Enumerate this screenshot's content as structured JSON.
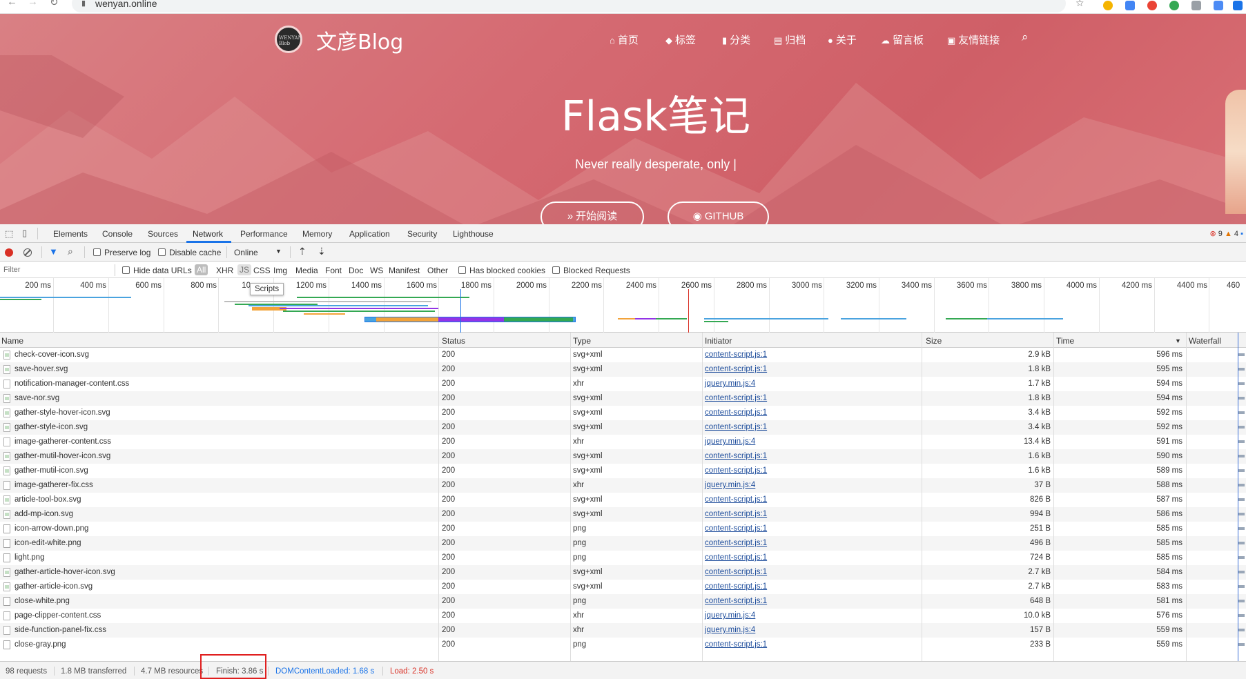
{
  "browser": {
    "url": "wenyan.online"
  },
  "site": {
    "title": "文彦Blog",
    "logo_text": "WENYAN Blob",
    "nav": [
      {
        "icon": "⌂",
        "label": "首页",
        "name": "nav-home"
      },
      {
        "icon": "◆",
        "label": "标签",
        "name": "nav-tags"
      },
      {
        "icon": "▮",
        "label": "分类",
        "name": "nav-categories"
      },
      {
        "icon": "▤",
        "label": "归档",
        "name": "nav-archive"
      },
      {
        "icon": "●",
        "label": "关于",
        "name": "nav-about"
      },
      {
        "icon": "☁",
        "label": "留言板",
        "name": "nav-guestbook"
      },
      {
        "icon": "▣",
        "label": "友情链接",
        "name": "nav-links"
      }
    ],
    "post_title": "Flask笔记",
    "subtitle": "Never really desperate, only |",
    "buttons": {
      "read": "开始阅读",
      "github": "GITHUB"
    }
  },
  "devtools": {
    "tabs": [
      "Elements",
      "Console",
      "Sources",
      "Network",
      "Performance",
      "Memory",
      "Application",
      "Security",
      "Lighthouse"
    ],
    "active_tab": "Network",
    "counters": {
      "errors": "9",
      "warnings": "4"
    },
    "toolbar": {
      "preserve_log": "Preserve log",
      "disable_cache": "Disable cache",
      "throttle": "Online"
    },
    "filter": {
      "placeholder": "Filter",
      "hide_data_urls": "Hide data URLs",
      "types": [
        "All",
        "XHR",
        "JS",
        "CSS",
        "Img",
        "Media",
        "Font",
        "Doc",
        "WS",
        "Manifest",
        "Other"
      ],
      "has_blocked_cookies": "Has blocked cookies",
      "blocked_requests": "Blocked Requests"
    },
    "timeline_ticks": [
      "200 ms",
      "400 ms",
      "600 ms",
      "800 ms",
      "10",
      "1200 ms",
      "1400 ms",
      "1600 ms",
      "1800 ms",
      "2000 ms",
      "2200 ms",
      "2400 ms",
      "2600 ms",
      "2800 ms",
      "3000 ms",
      "3200 ms",
      "3400 ms",
      "3600 ms",
      "3800 ms",
      "4000 ms",
      "4200 ms",
      "4400 ms",
      "460"
    ],
    "tooltip": "Scripts",
    "columns": [
      "Name",
      "Status",
      "Type",
      "Initiator",
      "Size",
      "Time",
      "Waterfall"
    ],
    "rows": [
      {
        "name": "check-cover-icon.svg",
        "status": "200",
        "type": "svg+xml",
        "initiator": "content-script.js:1",
        "size": "2.9 kB",
        "time": "596 ms",
        "icon": "svg"
      },
      {
        "name": "save-hover.svg",
        "status": "200",
        "type": "svg+xml",
        "initiator": "content-script.js:1",
        "size": "1.8 kB",
        "time": "595 ms",
        "icon": "svg"
      },
      {
        "name": "notification-manager-content.css",
        "status": "200",
        "type": "xhr",
        "initiator": "jquery.min.js:4",
        "size": "1.7 kB",
        "time": "594 ms",
        "icon": "doc"
      },
      {
        "name": "save-nor.svg",
        "status": "200",
        "type": "svg+xml",
        "initiator": "content-script.js:1",
        "size": "1.8 kB",
        "time": "594 ms",
        "icon": "svg"
      },
      {
        "name": "gather-style-hover-icon.svg",
        "status": "200",
        "type": "svg+xml",
        "initiator": "content-script.js:1",
        "size": "3.4 kB",
        "time": "592 ms",
        "icon": "svg"
      },
      {
        "name": "gather-style-icon.svg",
        "status": "200",
        "type": "svg+xml",
        "initiator": "content-script.js:1",
        "size": "3.4 kB",
        "time": "592 ms",
        "icon": "svg"
      },
      {
        "name": "image-gatherer-content.css",
        "status": "200",
        "type": "xhr",
        "initiator": "jquery.min.js:4",
        "size": "13.4 kB",
        "time": "591 ms",
        "icon": "doc"
      },
      {
        "name": "gather-mutil-hover-icon.svg",
        "status": "200",
        "type": "svg+xml",
        "initiator": "content-script.js:1",
        "size": "1.6 kB",
        "time": "590 ms",
        "icon": "svg"
      },
      {
        "name": "gather-mutil-icon.svg",
        "status": "200",
        "type": "svg+xml",
        "initiator": "content-script.js:1",
        "size": "1.6 kB",
        "time": "589 ms",
        "icon": "svg"
      },
      {
        "name": "image-gatherer-fix.css",
        "status": "200",
        "type": "xhr",
        "initiator": "jquery.min.js:4",
        "size": "37 B",
        "time": "588 ms",
        "icon": "doc"
      },
      {
        "name": "article-tool-box.svg",
        "status": "200",
        "type": "svg+xml",
        "initiator": "content-script.js:1",
        "size": "826 B",
        "time": "587 ms",
        "icon": "svg"
      },
      {
        "name": "add-mp-icon.svg",
        "status": "200",
        "type": "svg+xml",
        "initiator": "content-script.js:1",
        "size": "994 B",
        "time": "586 ms",
        "icon": "svg"
      },
      {
        "name": "icon-arrow-down.png",
        "status": "200",
        "type": "png",
        "initiator": "content-script.js:1",
        "size": "251 B",
        "time": "585 ms",
        "icon": "png"
      },
      {
        "name": "icon-edit-white.png",
        "status": "200",
        "type": "png",
        "initiator": "content-script.js:1",
        "size": "496 B",
        "time": "585 ms",
        "icon": "png"
      },
      {
        "name": "light.png",
        "status": "200",
        "type": "png",
        "initiator": "content-script.js:1",
        "size": "724 B",
        "time": "585 ms",
        "icon": "png"
      },
      {
        "name": "gather-article-hover-icon.svg",
        "status": "200",
        "type": "svg+xml",
        "initiator": "content-script.js:1",
        "size": "2.7 kB",
        "time": "584 ms",
        "icon": "svg"
      },
      {
        "name": "gather-article-icon.svg",
        "status": "200",
        "type": "svg+xml",
        "initiator": "content-script.js:1",
        "size": "2.7 kB",
        "time": "583 ms",
        "icon": "svg"
      },
      {
        "name": "close-white.png",
        "status": "200",
        "type": "png",
        "initiator": "content-script.js:1",
        "size": "648 B",
        "time": "581 ms",
        "icon": "png"
      },
      {
        "name": "page-clipper-content.css",
        "status": "200",
        "type": "xhr",
        "initiator": "jquery.min.js:4",
        "size": "10.0 kB",
        "time": "576 ms",
        "icon": "doc"
      },
      {
        "name": "side-function-panel-fix.css",
        "status": "200",
        "type": "xhr",
        "initiator": "jquery.min.js:4",
        "size": "157 B",
        "time": "559 ms",
        "icon": "doc"
      },
      {
        "name": "close-gray.png",
        "status": "200",
        "type": "png",
        "initiator": "content-script.js:1",
        "size": "233 B",
        "time": "559 ms",
        "icon": "png"
      }
    ],
    "status_bar": {
      "requests": "98 requests",
      "transferred": "1.8 MB transferred",
      "resources": "4.7 MB resources",
      "finish": "Finish: 3.86 s",
      "dom_content_loaded": "DOMContentLoaded: 1.68 s",
      "load": "Load: 2.50 s"
    }
  }
}
